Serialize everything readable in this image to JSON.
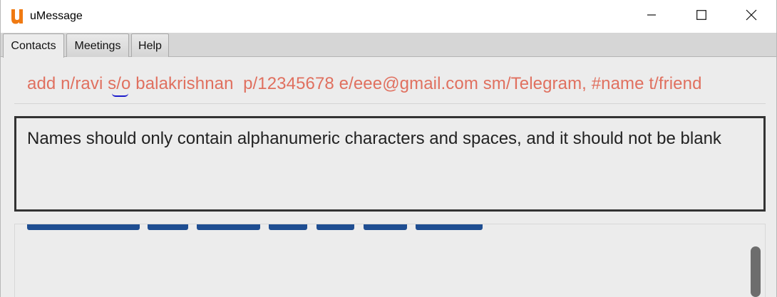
{
  "window": {
    "title": "uMessage",
    "logo_letter": "u",
    "accent_color": "#f07a12"
  },
  "tabs": [
    {
      "label": "Contacts",
      "active": true
    },
    {
      "label": "Meetings",
      "active": false
    },
    {
      "label": "Help",
      "active": false
    }
  ],
  "command": {
    "text": "add n/ravi s/o balakrishnan  p/12345678 e/eee@gmail.com sm/Telegram, #name t/friend",
    "text_color": "#e0705f"
  },
  "result": {
    "message": "Names should only contain alphanumeric characters and spaces, and it should not be blank"
  },
  "list": {
    "tag_color": "#1f4e92"
  },
  "icons": {
    "minimize": "minimize-icon",
    "maximize": "maximize-icon",
    "close": "close-icon"
  }
}
